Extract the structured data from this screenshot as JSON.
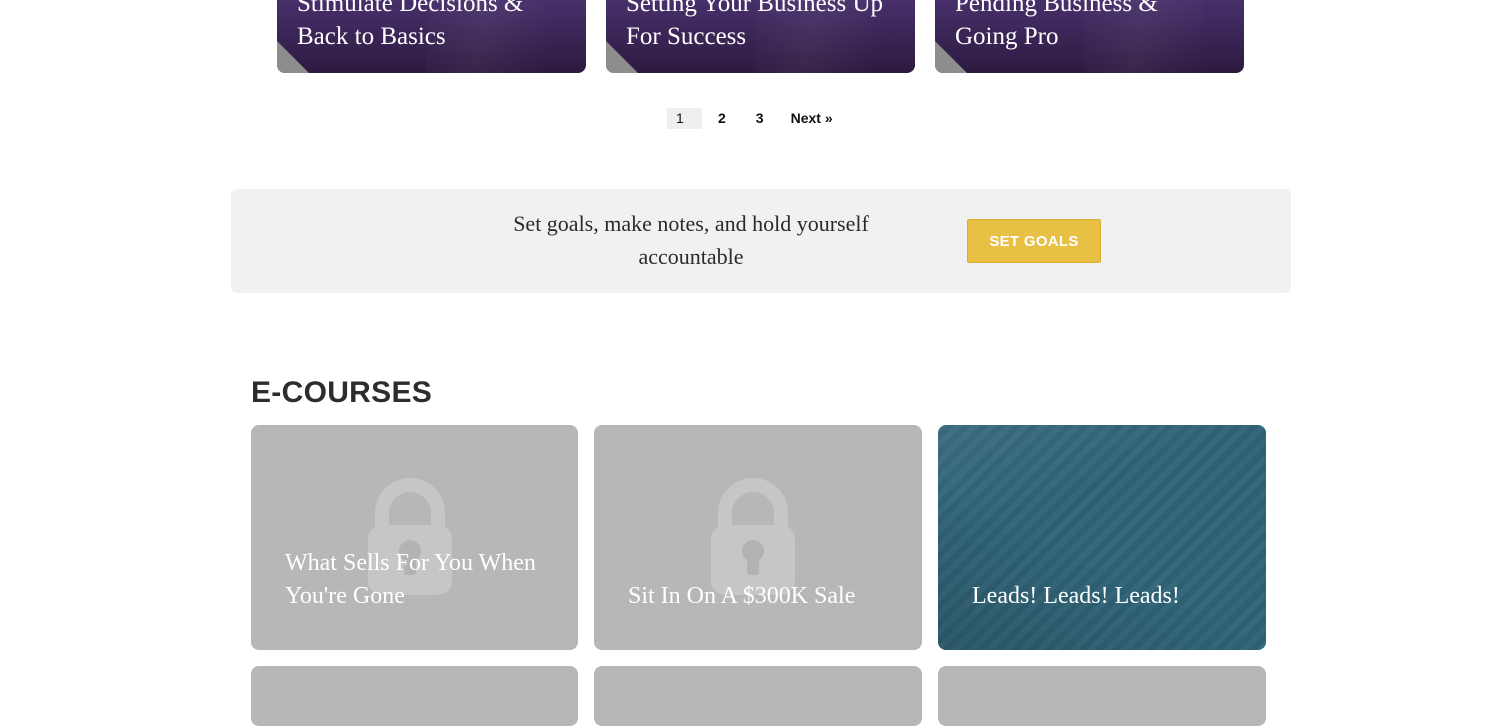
{
  "top_cards": [
    {
      "title": "Stimulate Decisions & Back to Basics"
    },
    {
      "title": "Setting Your Business Up For Success"
    },
    {
      "title": "Pending Business & Going Pro"
    }
  ],
  "pagination": {
    "pages": [
      "1",
      "2",
      "3"
    ],
    "current": "1",
    "next_label": "Next »"
  },
  "goals_banner": {
    "text": "Set goals, make notes, and hold yourself accountable",
    "button_label": "SET GOALS"
  },
  "ecourses": {
    "heading": "E-COURSES",
    "cards": [
      {
        "title": "What Sells For You When You're Gone",
        "locked": true
      },
      {
        "title": "Sit In On A $300K Sale",
        "locked": true
      },
      {
        "title": "Leads! Leads! Leads!",
        "locked": false
      }
    ]
  },
  "colors": {
    "top_card_purple": "#47306b",
    "button_gold": "#e8c044",
    "locked_gray": "#b7b7b7",
    "featured_teal": "#2f6377",
    "banner_bg": "#f1f1f1"
  },
  "icons": {
    "lock": "lock-icon",
    "corner": "corner-fold-icon"
  }
}
